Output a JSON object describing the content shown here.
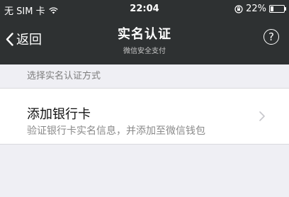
{
  "status_bar": {
    "carrier": "无 SIM 卡",
    "wifi_icon": "wifi-icon",
    "time": "22:04",
    "lock_icon": "orientation-lock-icon",
    "battery_percent": "22%",
    "battery_level": 0.22
  },
  "nav": {
    "back_label": "返回",
    "title": "实名认证",
    "subtitle": "微信安全支付",
    "help_icon": "help-icon",
    "help_glyph": "?"
  },
  "section": {
    "label": "选择实名认证方式"
  },
  "option": {
    "title": "添加银行卡",
    "description": "验证银行卡实名信息，并添加至微信钱包",
    "chevron_icon": "chevron-right-icon"
  },
  "colors": {
    "header_bg": "#2e3132",
    "page_bg": "#efeff4",
    "row_bg": "#ffffff"
  }
}
